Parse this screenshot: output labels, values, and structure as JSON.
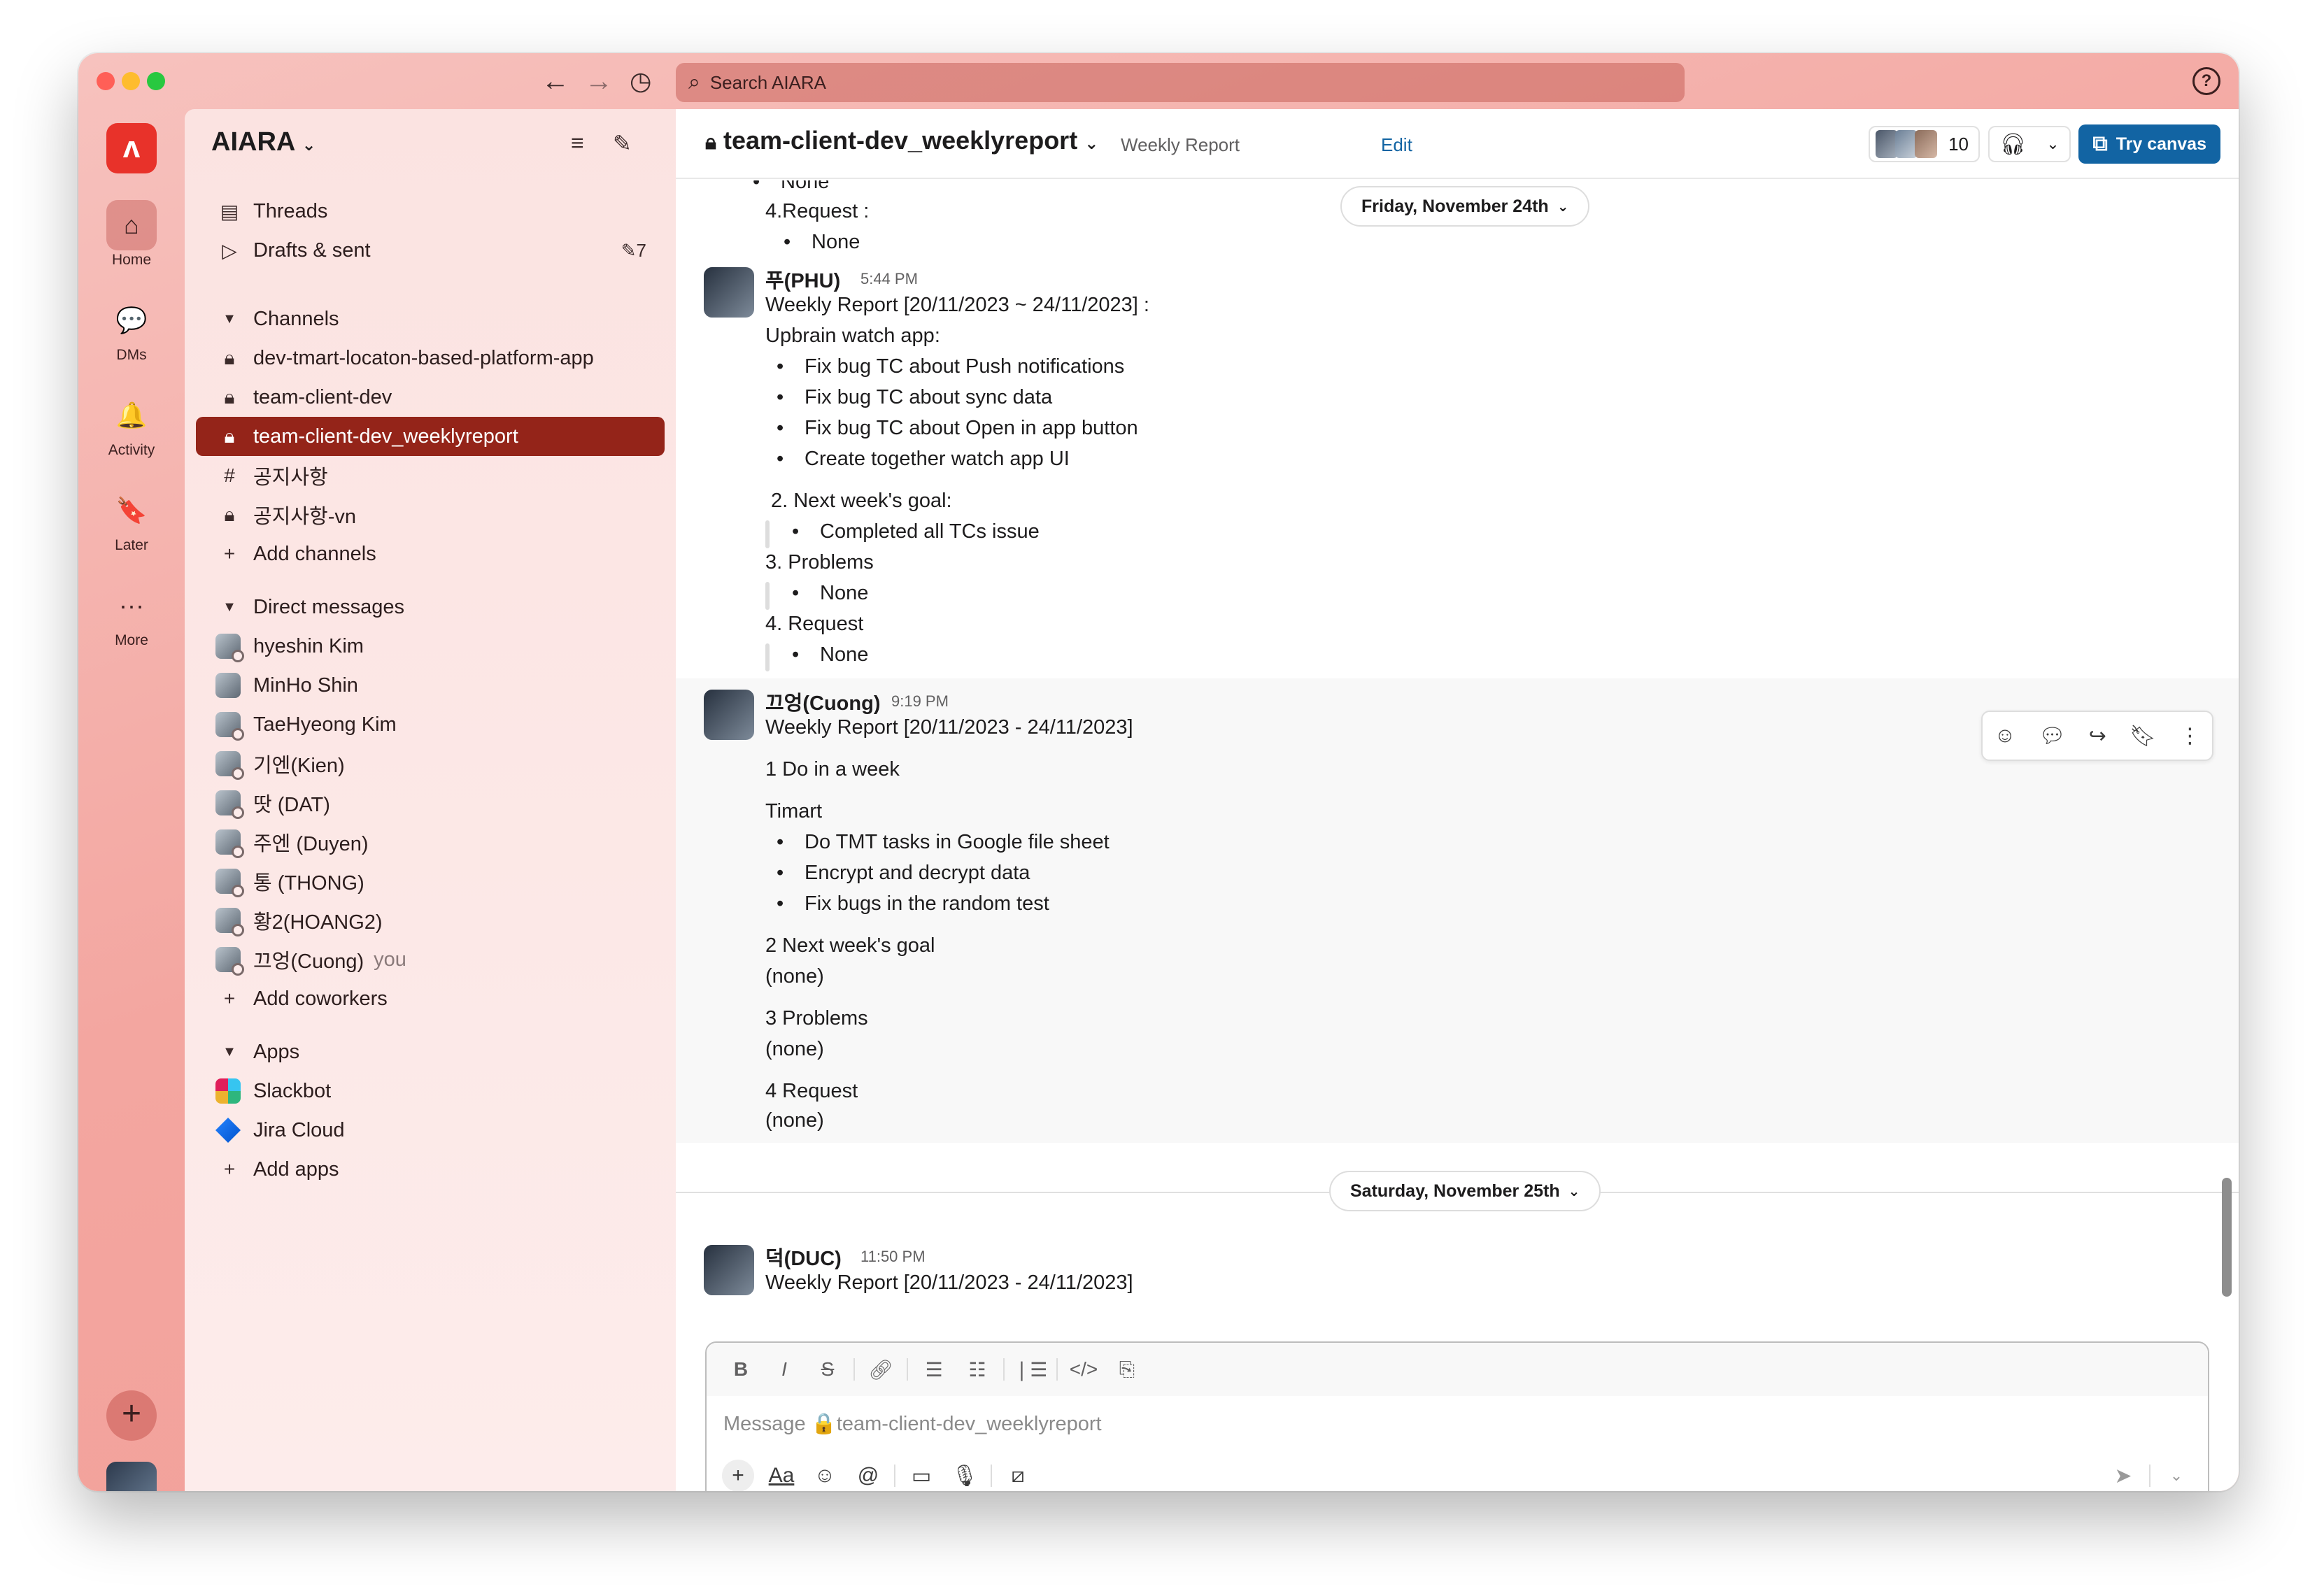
{
  "search": {
    "placeholder": "Search AIARA"
  },
  "rail": {
    "logo_glyph": "ʌ",
    "items": [
      {
        "label": "Home",
        "icon": "home-icon"
      },
      {
        "label": "DMs",
        "icon": "dms-icon"
      },
      {
        "label": "Activity",
        "icon": "bell-icon"
      },
      {
        "label": "Later",
        "icon": "bookmark-icon"
      },
      {
        "label": "More",
        "icon": "more-icon"
      }
    ]
  },
  "workspace": {
    "name": "AIARA"
  },
  "sidebar": {
    "threads": "Threads",
    "drafts": "Drafts & sent",
    "drafts_count": "7",
    "channels_header": "Channels",
    "channels": [
      {
        "name": "dev-tmart-locaton-based-platform-app",
        "type": "private"
      },
      {
        "name": "team-client-dev",
        "type": "private"
      },
      {
        "name": "team-client-dev_weeklyreport",
        "type": "private",
        "active": true
      },
      {
        "name": "공지사항",
        "type": "public"
      },
      {
        "name": "공지사항-vn",
        "type": "private"
      }
    ],
    "add_channels": "Add channels",
    "dm_header": "Direct messages",
    "dms": [
      {
        "name": "hyeshin Kim"
      },
      {
        "name": "MinHo Shin"
      },
      {
        "name": "TaeHyeong Kim"
      },
      {
        "name": "기엔(Kien)"
      },
      {
        "name": "땃 (DAT)"
      },
      {
        "name": "주엔 (Duyen)"
      },
      {
        "name": "통 (THONG)"
      },
      {
        "name": "황2(HOANG2)"
      },
      {
        "name": "끄엉(Cuong)",
        "suffix": "you"
      }
    ],
    "add_coworkers": "Add coworkers",
    "apps_header": "Apps",
    "apps": [
      {
        "name": "Slackbot"
      },
      {
        "name": "Jira Cloud"
      }
    ],
    "add_apps": "Add apps"
  },
  "header": {
    "channel": "team-client-dev_weeklyreport",
    "topic": "Weekly Report",
    "edit": "Edit",
    "member_count": "10",
    "try_canvas": "Try canvas"
  },
  "messages": {
    "top_partial": {
      "cut_line": "None",
      "request": "4.Request :",
      "request_item": "None"
    },
    "date1": "Friday, November 24th",
    "phu": {
      "author": "푸(PHU)",
      "time": "5:44 PM",
      "title": "Weekly Report [20/11/2023 ~ 24/11/2023] :",
      "section": "Upbrain watch app:",
      "items": [
        "Fix bug TC about Push notifications",
        "Fix bug TC about sync data",
        "Fix bug TC about Open in app button",
        "Create together watch app UI"
      ],
      "goal_h": "2. Next week's goal:",
      "goal_item": "Completed all TCs issue",
      "problems_h": "3. Problems",
      "problems_item": "None",
      "request_h": "4. Request",
      "request_item": "None"
    },
    "cuong": {
      "author": "끄엉(Cuong)",
      "time": "9:19 PM",
      "title": "Weekly Report [20/11/2023 - 24/11/2023]",
      "do_h": "1 Do in a week",
      "project": "Timart",
      "items": [
        "Do TMT tasks in Google file sheet",
        "Encrypt and decrypt data",
        "Fix bugs in the random test"
      ],
      "goal_h": "2 Next week's goal",
      "goal_v": "(none)",
      "problems_h": "3 Problems",
      "problems_v": "(none)",
      "request_h": "4 Request",
      "request_v": "(none)"
    },
    "date2": "Saturday, November 25th",
    "duc": {
      "author": "덕(DUC)",
      "time": "11:50 PM",
      "title": "Weekly Report [20/11/2023 - 24/11/2023]"
    }
  },
  "composer": {
    "placeholder": "Message 🔒team-client-dev_weeklyreport",
    "format_aa": "Aa"
  },
  "colors": {
    "accent": "#1264a3",
    "active_channel": "#942419",
    "workspace_logo": "#e8322a"
  }
}
